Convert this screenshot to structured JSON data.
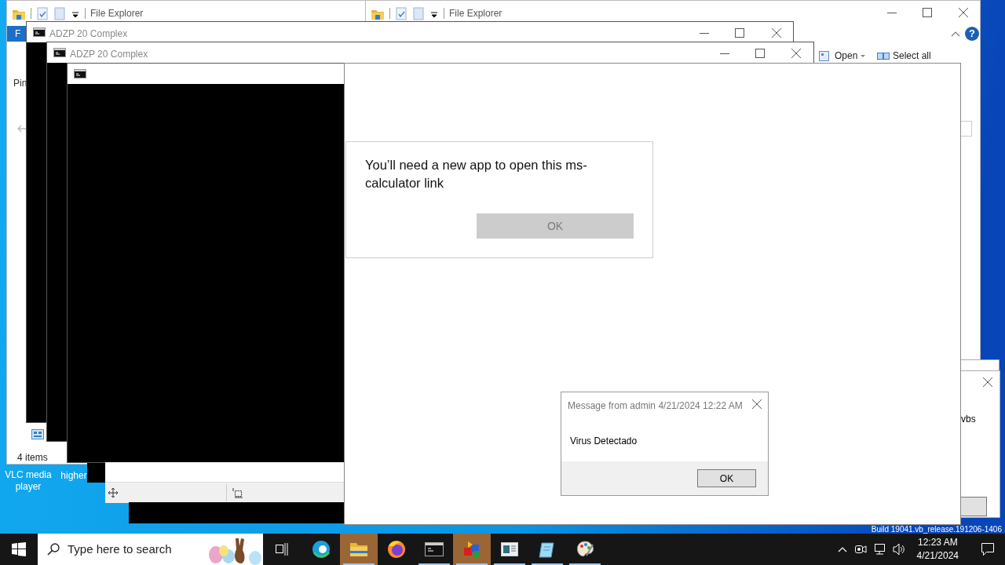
{
  "desktop": {
    "icons": [
      {
        "label": "VLC media player"
      },
      {
        "label": "higher"
      }
    ],
    "build_text": "Build 19041.vb_release.191206-1406"
  },
  "explorer_windows": [
    {
      "title": "File Explorer",
      "ribbon_tab": "F",
      "pin_label": "Pin",
      "status": "4 items"
    },
    {
      "title": "File Explorer",
      "help_glyph": "?",
      "ribbon_items": [
        {
          "kind": "open",
          "label": "Open",
          "dropdown": true
        },
        {
          "kind": "select",
          "label": "Select all",
          "dropdown": false
        }
      ]
    }
  ],
  "console_windows": [
    {
      "kind": "titled",
      "title": "ADZP 20 Complex"
    },
    {
      "kind": "titled",
      "title": "ADZP 20 Complex"
    },
    {
      "kind": "untitled"
    }
  ],
  "app_dialog": {
    "message": "You’ll need a new app to open this ms-calculator link",
    "button": {
      "label": "OK",
      "disabled": true
    }
  },
  "message_box": {
    "title": "Message from admin 4/21/2024 12:22 AM",
    "text": "Virus Detectado",
    "button": "OK"
  },
  "side_window": {
    "text": "vbs"
  },
  "taskbar": {
    "search_placeholder": "Type here to search",
    "apps": [
      {
        "kind": "edge",
        "running": false,
        "highlighted": false
      },
      {
        "kind": "explorer",
        "running": true,
        "highlighted": true
      },
      {
        "kind": "firefox",
        "running": false,
        "highlighted": false
      },
      {
        "kind": "console",
        "running": true,
        "highlighted": false
      },
      {
        "kind": "boxes",
        "running": true,
        "highlighted": true
      },
      {
        "kind": "window",
        "running": true,
        "highlighted": false
      },
      {
        "kind": "notepad",
        "running": true,
        "highlighted": false
      },
      {
        "kind": "paint",
        "running": true,
        "highlighted": false
      }
    ],
    "time": "12:23 AM",
    "date": "4/21/2024"
  }
}
